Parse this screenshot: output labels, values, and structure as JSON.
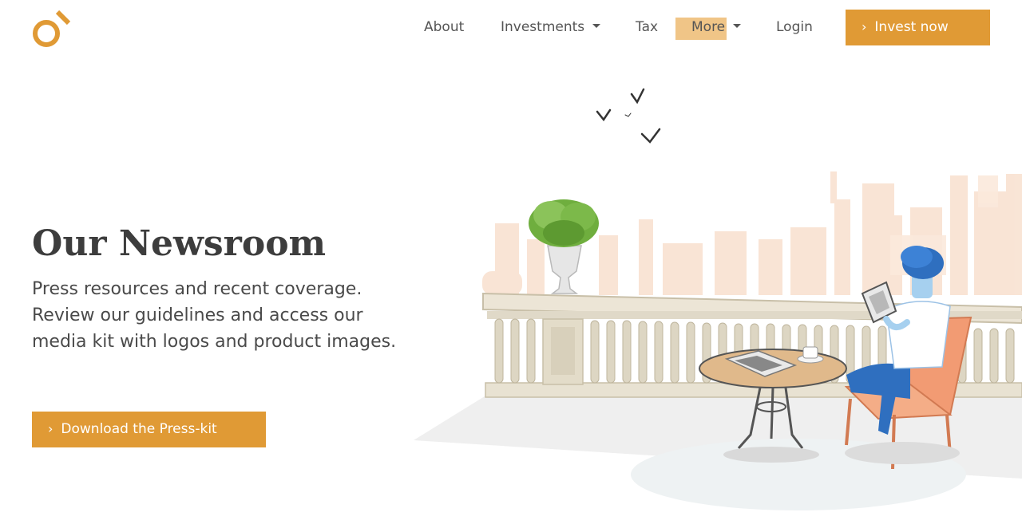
{
  "header": {
    "logo_icon": "ring-logo-icon",
    "nav": {
      "about": "About",
      "investments": "Investments",
      "tax": "Tax",
      "more": "More",
      "login": "Login"
    },
    "invest_button": "Invest now"
  },
  "hero": {
    "title": "Our Newsroom",
    "description": "Press resources and recent coverage. Review our guidelines and access our media kit with logos and product images.",
    "download_button": "Download the Press-kit"
  },
  "colors": {
    "accent": "#e09a35",
    "highlight": "#f0c587",
    "text_dark": "#3d3d3d"
  }
}
